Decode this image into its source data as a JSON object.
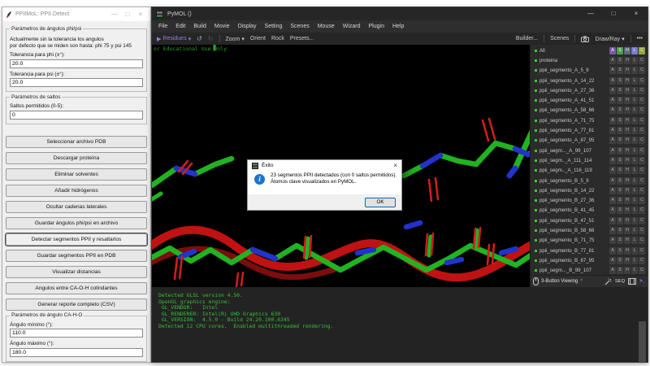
{
  "icons": {
    "caret_down": "▾",
    "play": "▶",
    "undo": "↺",
    "redo": "↻",
    "more": "•••",
    "minimize": "—",
    "maximize": "□",
    "close": "×",
    "caret_up": "^"
  },
  "left_window": {
    "title": "PPIIMoL: PPII Detect",
    "group_phi_psi": {
      "title": "Parámetros de ángulos phi/psi",
      "info_line1": "Actualmente sin la tolerancia los angulos",
      "info_line2": "por defecto que se miden son hasta: phi 75 y psi 145",
      "phi_label": "Tolerancia para phi (±°):",
      "phi_value": "20.0",
      "psi_label": "Tolerancia para psi (±°):",
      "psi_value": "20.0"
    },
    "group_saltos": {
      "title": "Parámetros de saltos",
      "label": "Saltos permitidos (0-5):",
      "value": "0"
    },
    "buttons": [
      "Seleccionar archivo PDB",
      "Descargar proteína",
      "Eliminar solventes",
      "Añadir hidrógenos",
      "Ocultar cadenas laterales",
      "Guardar ángulos phi/psi en archivo",
      "Detectar segmentos PPII y resaltarlos",
      "Guardar segmentos PPII en PDB",
      "Visualizar distancias",
      "Angulos entre CA-O-H colindantes",
      "Generar reporte completo (CSV)"
    ],
    "group_angulo": {
      "title": "Parámetros de ángulo CA-H-O",
      "min_label": "Ángulo mínimo (°):",
      "min_value": "110.0",
      "max_label": "Ángulo máximo (°):",
      "max_value": "180.0"
    }
  },
  "pymol": {
    "title": "PyMOL ()",
    "menus": [
      "File",
      "Edit",
      "Build",
      "Movie",
      "Display",
      "Setting",
      "Scenes",
      "Mouse",
      "Wizard",
      "Plugin",
      "Help"
    ],
    "toolbar": {
      "residues": "Residues",
      "zoom": "Zoom",
      "orient": "Orient",
      "rock": "Rock",
      "presets": "Presets...",
      "builder": "Builder...",
      "scenes": "Scenes",
      "drawray": "Draw/Ray"
    },
    "banner": "or Educational Use Only",
    "panel": {
      "letters": [
        "A",
        "S",
        "H",
        "L",
        "C"
      ],
      "rows": [
        "All",
        "proteina",
        "ppii_segmento_A_5_9",
        "ppii_segmento_A_14_22",
        "ppii_segmento_A_27_36",
        "ppii_segmento_A_41_51",
        "ppii_segmento_A_58_66",
        "ppii_segmento_A_71_75",
        "ppii_segmento_A_77_81",
        "ppii_segmento_A_87_95",
        "ppii_segm..._A_99_107",
        "ppii_segm.._A_111_114",
        "ppii_segm.._A_116_119",
        "ppii_segmento_B_5_9",
        "ppii_segmento_B_14_22",
        "ppii_segmento_B_27_36",
        "ppii_segmento_B_41_45",
        "ppii_segmento_B_47_51",
        "ppii_segmento_B_58_66",
        "ppii_segmento_B_71_75",
        "ppii_segmento_B_77_81",
        "ppii_segmento_B_87_95",
        "ppii_segm..._B_99_107"
      ]
    },
    "mousebar": {
      "label": "3-Button Viewing",
      "seq": "SEQ",
      "prompt": ">_"
    },
    "dialog": {
      "title": "Éxito",
      "line1": "23 segmentos PPII detectados (con 0 saltos permitidos).",
      "line2": "Átomos clave visualizados en PyMOL.",
      "ok": "OK"
    },
    "console_lines": [
      "Detected GLSL version 4.50.",
      "OpenGL graphics engine:",
      " GL_VENDOR:   Intel",
      " GL_RENDERER: Intel(R) UHD Graphics 630",
      " GL_VERSION:  4.5.0 - Build 24.20.100.6345",
      "Detected 12 CPU cores.  Enabled multithreaded rendering."
    ]
  },
  "colors": {
    "accent_purple": "#8f7fe0",
    "pymol_green": "#21b321",
    "nitrogen_blue": "#2233cc",
    "oxygen_red": "#cf1d1d",
    "banner_green": "#2f9e2f",
    "console_green": "#35c035",
    "dialog_info_blue": "#1777d2",
    "ok_focus_border": "#0067c0",
    "row_bullet_green": "#2fd12f",
    "btn_A": "#7e57a8",
    "btn_S": "#4c9e4c",
    "btn_H": "#5b6b78",
    "btn_L": "#7b7bcf",
    "btn_C": "#93a73b"
  }
}
